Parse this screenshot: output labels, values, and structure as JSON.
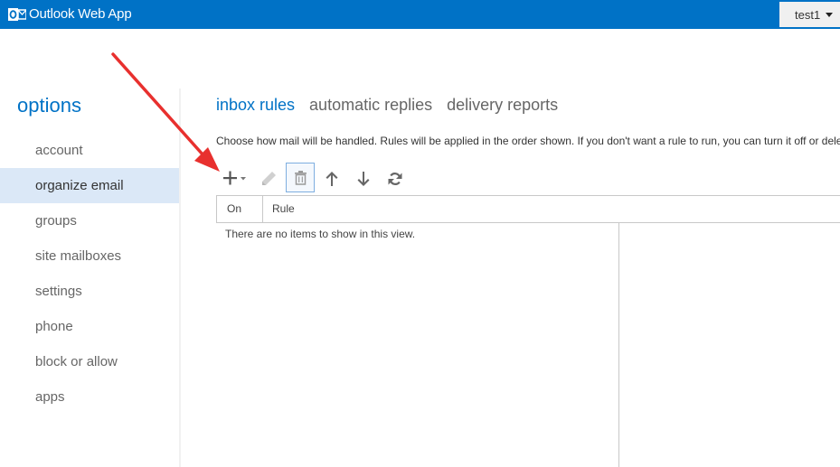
{
  "header": {
    "app_title": "Outlook Web App",
    "logo_icon": "outlook-logo-icon",
    "user_name": "test1",
    "brand_color": "#0072c6"
  },
  "sidebar": {
    "title": "options",
    "items": [
      {
        "label": "account",
        "selected": false
      },
      {
        "label": "organize email",
        "selected": true
      },
      {
        "label": "groups",
        "selected": false
      },
      {
        "label": "site mailboxes",
        "selected": false
      },
      {
        "label": "settings",
        "selected": false
      },
      {
        "label": "phone",
        "selected": false
      },
      {
        "label": "block or allow",
        "selected": false
      },
      {
        "label": "apps",
        "selected": false
      }
    ]
  },
  "tabs": [
    {
      "label": "inbox rules",
      "active": true
    },
    {
      "label": "automatic replies",
      "active": false
    },
    {
      "label": "delivery reports",
      "active": false
    }
  ],
  "description": "Choose how mail will be handled. Rules will be applied in the order shown. If you don't want a rule to run, you can turn it off or delete it.",
  "toolbar": {
    "buttons": [
      "new-icon",
      "edit-icon",
      "delete-icon",
      "move-up-icon",
      "move-down-icon",
      "refresh-icon"
    ]
  },
  "table": {
    "columns": [
      "On",
      "Rule"
    ],
    "empty_message": "There are no items to show in this view."
  },
  "annotation": {
    "arrow_color": "#e8302e"
  }
}
